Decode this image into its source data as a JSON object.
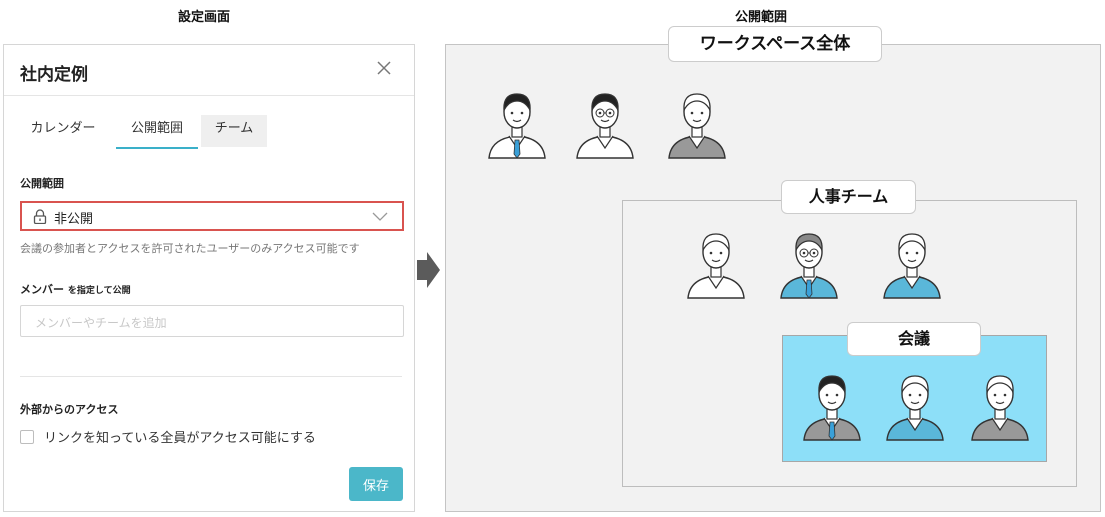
{
  "captions": {
    "settings": "設定画面",
    "scope": "公開範囲"
  },
  "dialog": {
    "title": "社内定例",
    "tabs": [
      {
        "label": "カレンダー"
      },
      {
        "label": "公開範囲",
        "active": true
      },
      {
        "label": "チーム"
      }
    ],
    "visibility": {
      "label": "公開範囲",
      "selected": "非公開",
      "help": "会議の参加者とアクセスを許可されたユーザーのみアクセス可能です"
    },
    "members": {
      "label_main": "メンバー",
      "label_small": "を指定して公開",
      "placeholder": "メンバーやチームを追加"
    },
    "external": {
      "label": "外部からのアクセス",
      "checkbox_label": "リンクを知っている全員がアクセス可能にする",
      "checked": false
    },
    "save_label": "保存"
  },
  "diagram": {
    "workspace": {
      "label": "ワークスペース全体",
      "people": 3
    },
    "team": {
      "label": "人事チーム",
      "people": 3
    },
    "meeting": {
      "label": "会議",
      "people": 3
    }
  },
  "colors": {
    "accent": "#4bb7c9",
    "tab_underline": "#3ab0c9",
    "highlight_border": "#d9534f",
    "meeting_fill": "#8ddff8",
    "region_fill": "#f2f2f2",
    "tie": "#3aa0d8"
  },
  "icons": [
    "close-icon",
    "lock-icon",
    "chevron-down-icon",
    "arrow-right-icon",
    "person-icon"
  ]
}
